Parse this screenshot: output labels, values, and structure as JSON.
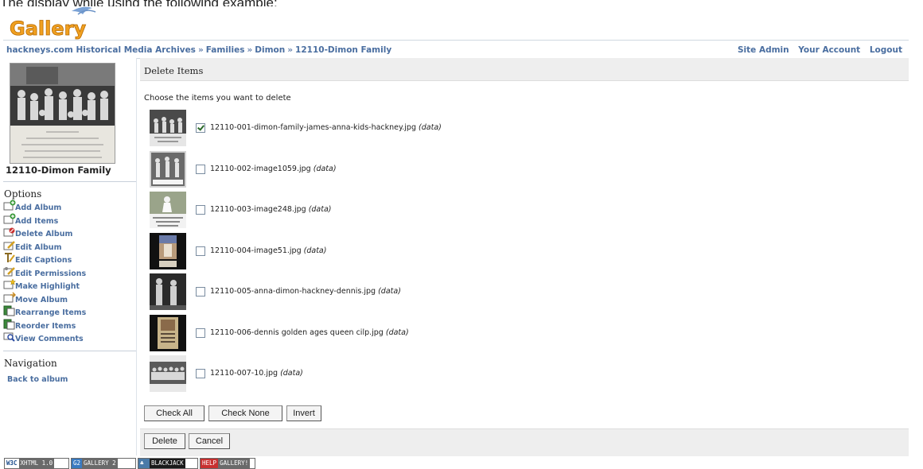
{
  "page_top_text": "The display while using the following example:",
  "logo": {
    "text": "Gallery"
  },
  "breadcrumb": {
    "items": [
      "hackneys.com Historical Media Archives",
      "Families",
      "Dimon"
    ],
    "separator": "»",
    "current": "12110-Dimon Family"
  },
  "system_links": {
    "site_admin": "Site Admin",
    "your_account": "Your Account",
    "logout": "Logout"
  },
  "sidebar": {
    "album_title": "12110-Dimon Family",
    "options_heading": "Options",
    "options": [
      {
        "label": "Add Album",
        "icon": "add-album-icon"
      },
      {
        "label": "Add Items",
        "icon": "add-items-icon"
      },
      {
        "label": "Delete Album",
        "icon": "delete-album-icon"
      },
      {
        "label": "Edit Album",
        "icon": "edit-album-icon"
      },
      {
        "label": "Edit Captions",
        "icon": "edit-captions-icon"
      },
      {
        "label": "Edit Permissions",
        "icon": "edit-permissions-icon"
      },
      {
        "label": "Make Highlight",
        "icon": "make-highlight-icon"
      },
      {
        "label": "Move Album",
        "icon": "move-album-icon"
      },
      {
        "label": "Rearrange Items",
        "icon": "rearrange-items-icon"
      },
      {
        "label": "Reorder Items",
        "icon": "reorder-items-icon"
      },
      {
        "label": "View Comments",
        "icon": "view-comments-icon"
      }
    ],
    "navigation_heading": "Navigation",
    "back_link": "Back to album"
  },
  "main": {
    "heading": "Delete Items",
    "instruction": "Choose the items you want to delete",
    "data_label": "(data)",
    "items": [
      {
        "filename": "12110-001-dimon-family-james-anna-kids-hackney.jpg",
        "checked": true
      },
      {
        "filename": "12110-002-image1059.jpg",
        "checked": false
      },
      {
        "filename": "12110-003-image248.jpg",
        "checked": false
      },
      {
        "filename": "12110-004-image51.jpg",
        "checked": false
      },
      {
        "filename": "12110-005-anna-dimon-hackney-dennis.jpg",
        "checked": false
      },
      {
        "filename": "12110-006-dennis golden ages queen cilp.jpg",
        "checked": false
      },
      {
        "filename": "12110-007-10.jpg",
        "checked": false
      }
    ],
    "buttons": {
      "check_all": "Check All",
      "check_none": "Check None",
      "invert": "Invert"
    },
    "actions": {
      "delete": "Delete",
      "cancel": "Cancel"
    }
  },
  "badges": [
    {
      "left": "W3C",
      "right": "XHTML 1.0"
    },
    {
      "left": "G2",
      "right": "GALLERY 2"
    },
    {
      "left": "",
      "right": "BLACKJACK"
    },
    {
      "left": "HELP",
      "right": "GALLERY!"
    }
  ],
  "colors": {
    "link": "#4a6ea0",
    "header_bg": "#eeeeee",
    "logo_orange": "#f0a020"
  }
}
